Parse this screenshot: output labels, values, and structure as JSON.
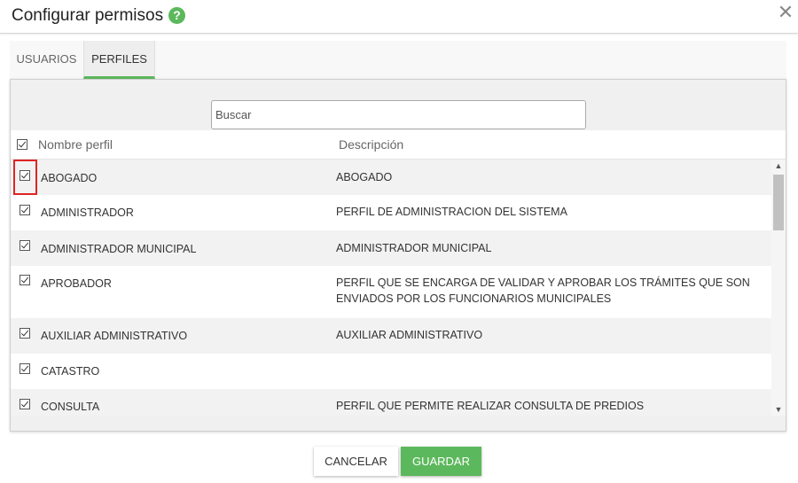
{
  "dialog": {
    "title": "Configurar permisos",
    "help_icon": "question-circle-icon",
    "close_icon": "close-icon",
    "close_glyph": "✕"
  },
  "tabs": [
    {
      "label": "USUARIOS",
      "active": false
    },
    {
      "label": "PERFILES",
      "active": true
    }
  ],
  "search": {
    "placeholder": "Buscar",
    "value": ""
  },
  "table": {
    "columns": [
      "Nombre perfil",
      "Descripción"
    ],
    "select_all_checked": true,
    "rows": [
      {
        "name": "ABOGADO",
        "description": "ABOGADO",
        "checked": true,
        "highlighted": true
      },
      {
        "name": "ADMINISTRADOR",
        "description": "PERFIL DE ADMINISTRACION DEL SISTEMA",
        "checked": true
      },
      {
        "name": "ADMINISTRADOR MUNICIPAL",
        "description": "ADMINISTRADOR MUNICIPAL",
        "checked": true
      },
      {
        "name": "APROBADOR",
        "description": "PERFIL QUE SE ENCARGA DE VALIDAR Y APROBAR LOS TRÁMITES QUE SON ENVIADOS POR LOS FUNCIONARIOS MUNICIPALES",
        "checked": true
      },
      {
        "name": "AUXILIAR ADMINISTRATIVO",
        "description": "AUXILIAR ADMINISTRATIVO",
        "checked": true
      },
      {
        "name": "CATASTRO",
        "description": "",
        "checked": true
      },
      {
        "name": "CONSULTA",
        "description": "PERFIL QUE PERMITE REALIZAR CONSULTA DE PREDIOS",
        "checked": true
      }
    ]
  },
  "buttons": {
    "cancel": "CANCELAR",
    "save": "GUARDAR"
  },
  "colors": {
    "accent": "#5cb85c",
    "highlight": "#e02424"
  }
}
